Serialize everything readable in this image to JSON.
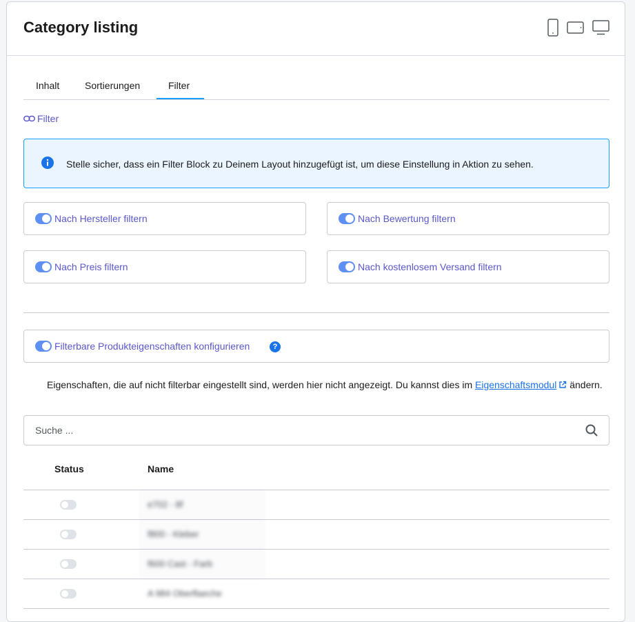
{
  "header": {
    "title": "Category listing",
    "devices": [
      "mobile-icon",
      "tablet-icon",
      "desktop-icon"
    ]
  },
  "tabs": [
    {
      "label": "Inhalt",
      "active": false
    },
    {
      "label": "Sortierungen",
      "active": false
    },
    {
      "label": "Filter",
      "active": true
    }
  ],
  "inherit_link": {
    "label": "Filter",
    "icon": "link-icon"
  },
  "info": {
    "icon": "info-icon",
    "text": "Stelle sicher, dass ein Filter Block zu Deinem Layout hinzugefügt ist, um diese Einstellung in Aktion zu sehen."
  },
  "filters": [
    {
      "label": "Nach Hersteller filtern",
      "enabled": true
    },
    {
      "label": "Nach Bewertung filtern",
      "enabled": true
    },
    {
      "label": "Nach Preis filtern",
      "enabled": true
    },
    {
      "label": "Nach kostenlosem Versand filtern",
      "enabled": true
    }
  ],
  "properties": {
    "label": "Filterbare Produkteigenschaften konfigurieren",
    "enabled": true,
    "help_icon": "?",
    "hint_before": "Eigenschaften, die auf nicht filterbar eingestellt sind, werden hier nicht angezeigt. Du kannst dies im ",
    "hint_link": "Eigenschaftsmodul",
    "hint_after": " ändern."
  },
  "search": {
    "placeholder": "Suche ...",
    "value": ""
  },
  "table": {
    "columns": [
      "Status",
      "Name"
    ],
    "rows": [
      {
        "name": "e702 - 8f",
        "enabled": false
      },
      {
        "name": "f800 - Kleber",
        "enabled": false
      },
      {
        "name": "f600 Cast - Farb",
        "enabled": false
      },
      {
        "name": "A 984 Oberflaeche",
        "enabled": false
      }
    ]
  },
  "colors": {
    "accent": "#189eff",
    "link": "#5b57c9",
    "toggle_on": "#5e8ff2",
    "toggle_off": "#dfe3e8",
    "info_bg": "#eaf5ff"
  }
}
